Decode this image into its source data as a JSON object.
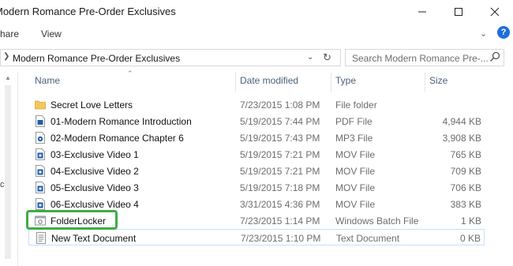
{
  "window": {
    "title": "Modern Romance Pre-Order Exclusives"
  },
  "ribbon": {
    "tabs": [
      {
        "label": "Share"
      },
      {
        "label": "View"
      }
    ],
    "help": "?"
  },
  "address": {
    "path": "Modern Romance Pre-Order Exclusives"
  },
  "search": {
    "placeholder": "Search Modern Romance Pre-..."
  },
  "nav": {
    "partial_label": "c"
  },
  "columns": {
    "name": "Name",
    "date": "Date modified",
    "type": "Type",
    "size": "Size"
  },
  "files": [
    {
      "name": "Secret Love Letters",
      "date": "7/23/2015 1:08 PM",
      "type": "File folder",
      "size": "",
      "icon": "folder-icon"
    },
    {
      "name": "01-Modern Romance Introduction",
      "date": "5/19/2015 7:44 PM",
      "type": "PDF File",
      "size": "4,944 KB",
      "icon": "pdf-file-icon"
    },
    {
      "name": "02-Modern Romance Chapter 6",
      "date": "5/19/2015 7:43 PM",
      "type": "MP3 File",
      "size": "3,908 KB",
      "icon": "mp3-file-icon"
    },
    {
      "name": "03-Exclusive Video 1",
      "date": "5/19/2015 7:21 PM",
      "type": "MOV File",
      "size": "765 KB",
      "icon": "mov-file-icon"
    },
    {
      "name": "04-Exclusive Video 2",
      "date": "5/19/2015 7:21 PM",
      "type": "MOV File",
      "size": "709 KB",
      "icon": "mov-file-icon"
    },
    {
      "name": "05-Exclusive Video 3",
      "date": "5/19/2015 7:18 PM",
      "type": "MOV File",
      "size": "706 KB",
      "icon": "mov-file-icon"
    },
    {
      "name": "06-Exclusive Video 4",
      "date": "3/31/2015 4:36 PM",
      "type": "MOV File",
      "size": "383 KB",
      "icon": "mov-file-icon"
    },
    {
      "name": "FolderLocker",
      "date": "7/23/2015 1:14 PM",
      "type": "Windows Batch File",
      "size": "1 KB",
      "icon": "batch-file-icon"
    },
    {
      "name": "New Text Document",
      "date": "7/23/2015 1:10 PM",
      "type": "Text Document",
      "size": "0 KB",
      "icon": "text-file-icon"
    }
  ],
  "colors": {
    "highlight": "#3cae45",
    "folder": "#f4c75c",
    "file_blue": "#1e5ea8",
    "header_text": "#4c607a"
  }
}
